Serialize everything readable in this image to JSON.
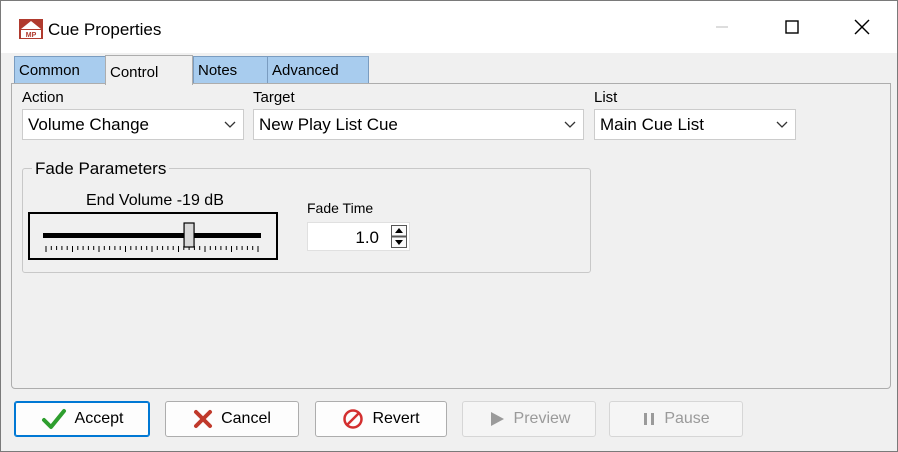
{
  "window": {
    "title": "Cue Properties",
    "app_icon_text": "MP"
  },
  "tabs": [
    {
      "label": "Common",
      "active": false
    },
    {
      "label": "Control",
      "active": true
    },
    {
      "label": "Notes",
      "active": false
    },
    {
      "label": "Advanced",
      "active": false
    }
  ],
  "fields": {
    "action": {
      "label": "Action",
      "value": "Volume Change"
    },
    "target": {
      "label": "Target",
      "value": "New Play List Cue"
    },
    "list": {
      "label": "List",
      "value": "Main Cue List"
    }
  },
  "fade": {
    "group_title": "Fade Parameters",
    "end_volume_label": "End Volume -19 dB",
    "slider_level_fraction": 0.67,
    "fade_time_label": "Fade Time",
    "fade_time_value": "1.0"
  },
  "buttons": {
    "accept": "Accept",
    "cancel": "Cancel",
    "revert": "Revert",
    "preview": "Preview",
    "pause": "Pause"
  },
  "colors": {
    "tab_inactive": "#a8ccee",
    "accept_check": "#2e9e2e",
    "cancel_x": "#c0392b",
    "revert_icon": "#d32f2f",
    "focus_border": "#0078d4"
  }
}
